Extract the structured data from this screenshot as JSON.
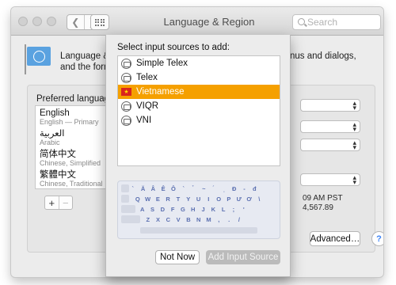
{
  "window": {
    "title": "Language & Region"
  },
  "search": {
    "placeholder": "Search"
  },
  "description": {
    "left_line1": "Language & R",
    "left_line2": "and the forma",
    "right_line1": "nus and dialogs,",
    "right_line2": ""
  },
  "preferred": {
    "title": "Preferred languages:",
    "languages": [
      {
        "name": "English",
        "sub": "English — Primary"
      },
      {
        "name": "العربية",
        "sub": "Arabic"
      },
      {
        "name": "简体中文",
        "sub": "Chinese, Simplified"
      },
      {
        "name": "繁體中文",
        "sub": "Chinese, Traditional"
      }
    ],
    "add": "+",
    "remove": "−"
  },
  "right_panel": {
    "time": "09 AM PST",
    "number": "4,567.89"
  },
  "buttons": {
    "advanced": "Advanced…",
    "help": "?"
  },
  "sheet": {
    "prompt": "Select input sources to add:",
    "sources": [
      {
        "label": "Simple Telex",
        "selected": false
      },
      {
        "label": "Telex",
        "selected": false
      },
      {
        "label": "Vietnamese",
        "selected": true
      },
      {
        "label": "VIQR",
        "selected": false
      },
      {
        "label": "VNI",
        "selected": false
      }
    ],
    "keyboard_rows": [
      [
        "`",
        "Ă",
        "Â",
        "Ê",
        "Ô",
        "`",
        "̉",
        "~",
        "́",
        "̣",
        "Đ",
        "-",
        "đ"
      ],
      [
        "Q",
        "W",
        "E",
        "R",
        "T",
        "Y",
        "U",
        "I",
        "O",
        "P",
        "Ư",
        "Ơ",
        "\\"
      ],
      [
        "A",
        "S",
        "D",
        "F",
        "G",
        "H",
        "J",
        "K",
        "L",
        ";",
        "'"
      ],
      [
        "Z",
        "X",
        "C",
        "V",
        "B",
        "N",
        "M",
        ",",
        ".",
        "/"
      ]
    ],
    "not_now": "Not Now",
    "add_source": "Add Input Source"
  },
  "colors": {
    "selection": "#f5a000",
    "key_text": "#5a6fb0",
    "help_blue": "#3b82f6"
  }
}
